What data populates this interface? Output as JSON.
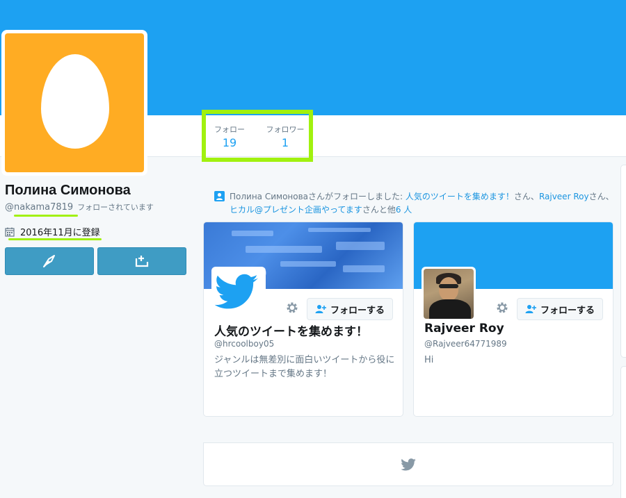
{
  "profile": {
    "name": "Полина Симонова",
    "screen_name": "@nakama7819",
    "follows_you": "フォローされています",
    "joined": "2016年11月に登録"
  },
  "stats": {
    "following_label": "フォロー",
    "following_value": "19",
    "followers_label": "フォロワー",
    "followers_value": "1"
  },
  "activity": {
    "prefix": "Полина Симоноваさんがフォローしました: ",
    "link1": "人気のツイートを集めます！",
    "sep1": "さん、",
    "link2": "Rajveer Roy",
    "sep2": "さん、",
    "link3": "ヒカル@プレゼント企画やってます",
    "suffix": "さんと他",
    "link4": "6 人"
  },
  "cards": [
    {
      "name": "人気のツイートを集めます！",
      "handle": "@hrcoolboy05",
      "bio": "ジャンルは無差別に面白いツイートから役に立つツイートまで集めます！",
      "follow_label": "フォローする"
    },
    {
      "name": "Rajveer Roy",
      "handle": "@Rajveer64771989",
      "bio": "Hi",
      "follow_label": "フォローする"
    }
  ],
  "colors": {
    "brand_blue": "#1da1f2",
    "highlight_green": "#a1f10f",
    "egg_avatar_bg": "#ffac23"
  },
  "icons": {
    "tweet_button": "quill-icon",
    "dm_button": "message-plus-icon",
    "calendar": "calendar-icon",
    "activity": "person-icon",
    "gear": "gear-icon",
    "follow": "person-plus-icon",
    "bird": "twitter-bird-icon"
  }
}
